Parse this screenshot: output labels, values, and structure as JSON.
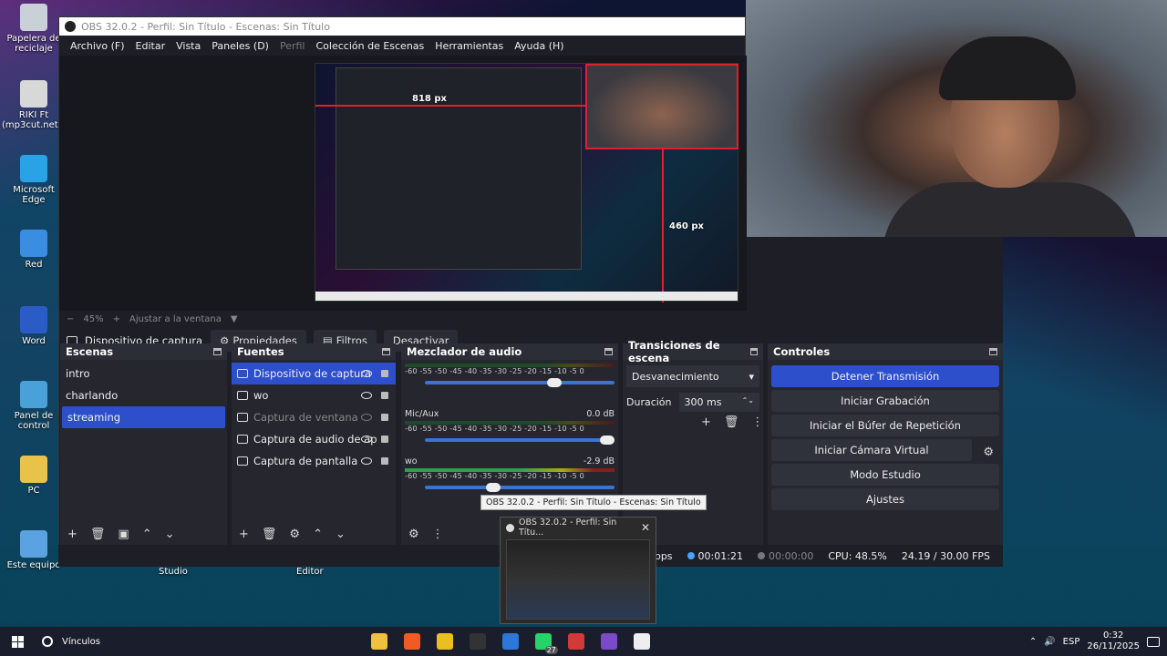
{
  "desktop": {
    "icons": [
      {
        "label": "Papelera de reciclaje",
        "color": "#c9d0d8"
      },
      {
        "label": "RIKI Ft (mp3cut.net)...",
        "color": "#d8d8d8"
      },
      {
        "label": "Microsoft Edge",
        "color": "#2aa3e6"
      },
      {
        "label": "Red",
        "color": "#3a8de0"
      },
      {
        "label": "Word",
        "color": "#2b5cc5"
      },
      {
        "label": "Panel de control",
        "color": "#4aa0d8"
      },
      {
        "label": "PC",
        "color": "#e9c24a"
      },
      {
        "label": "Este equipo",
        "color": "#5aa3e0"
      }
    ],
    "bottom_labels": [
      "Studio",
      "Editor"
    ]
  },
  "obs": {
    "title": "OBS 32.0.2 - Perfil: Sin Título - Escenas: Sin Título",
    "menu": [
      {
        "label": "Archivo (F)",
        "disabled": false
      },
      {
        "label": "Editar",
        "disabled": false
      },
      {
        "label": "Vista",
        "disabled": false
      },
      {
        "label": "Paneles (D)",
        "disabled": false
      },
      {
        "label": "Perfil",
        "disabled": true
      },
      {
        "label": "Colección de Escenas",
        "disabled": false
      },
      {
        "label": "Herramientas",
        "disabled": false
      },
      {
        "label": "Ayuda (H)",
        "disabled": false
      }
    ],
    "preview": {
      "px_label_width": "818 px",
      "px_label_height": "460 px"
    },
    "zoom": {
      "minus": "−",
      "value": "45%",
      "plus": "+",
      "fit_label": "Ajustar a la ventana",
      "dropdown": "▼"
    },
    "source_toolbar": {
      "source_name": "Dispositivo de captura de v",
      "properties": "Propiedades",
      "filters": "Filtros",
      "deactivate": "Desactivar"
    },
    "scenes": {
      "title": "Escenas",
      "items": [
        "intro",
        "charlando",
        "streaming"
      ],
      "active_index": 2
    },
    "sources": {
      "title": "Fuentes",
      "items": [
        {
          "label": "Dispositivo de captura",
          "active": true,
          "hidden": false
        },
        {
          "label": "wo",
          "active": false,
          "hidden": false
        },
        {
          "label": "Captura de ventana",
          "active": false,
          "hidden": true
        },
        {
          "label": "Captura de audio de ap",
          "active": false,
          "hidden": false
        },
        {
          "label": "Captura de pantalla",
          "active": false,
          "hidden": false
        }
      ]
    },
    "mixer": {
      "title": "Mezclador de audio",
      "scale": "-60 -55 -50 -45 -40 -35 -30 -25 -20 -15 -10 -5 0",
      "tracks": [
        {
          "name": "",
          "db": "",
          "level": 0.0,
          "volume": 0.72
        },
        {
          "name": "Mic/Aux",
          "db": "0.0 dB",
          "level": 0.0,
          "volume": 1.0
        },
        {
          "name": "wo",
          "db": "-2.9 dB",
          "level": 0.55,
          "volume": 0.4
        }
      ]
    },
    "transitions": {
      "title": "Transiciones de escena",
      "selected": "Desvanecimiento",
      "duration_label": "Duración",
      "duration_value": "300 ms"
    },
    "controls": {
      "title": "Controles",
      "buttons": [
        "Detener Transmisión",
        "Iniciar Grabación",
        "Iniciar el Búfer de Repetición",
        "Iniciar Cámara Virtual",
        "Modo Estudio",
        "Ajustes"
      ]
    },
    "status": {
      "bitrate": "3770 kbps",
      "stream_time": "00:01:21",
      "rec_time": "00:00:00",
      "cpu": "CPU: 48.5%",
      "fps": "24.19 / 30.00 FPS"
    }
  },
  "tooltip": "OBS 32.0.2 - Perfil: Sin Título - Escenas: Sin Título",
  "thumb_popup": {
    "title": "OBS 32.0.2 - Perfil: Sin Títu..."
  },
  "taskbar": {
    "search_label": "Vínculos",
    "apps": [
      {
        "name": "file-explorer",
        "color": "#f0c040"
      },
      {
        "name": "brave-browser",
        "color": "#f05a24"
      },
      {
        "name": "app-yellow",
        "color": "#e8c020"
      },
      {
        "name": "obs",
        "color": "#333333"
      },
      {
        "name": "store",
        "color": "#2b78d8"
      },
      {
        "name": "whatsapp",
        "color": "#25d366"
      },
      {
        "name": "app-red",
        "color": "#d23a3a"
      },
      {
        "name": "app-purple",
        "color": "#7a4ac8"
      },
      {
        "name": "notepad",
        "color": "#eeeeee"
      }
    ],
    "whatsapp_badge": "27",
    "language": "ESP",
    "time": "0:32",
    "date": "26/11/2025"
  }
}
